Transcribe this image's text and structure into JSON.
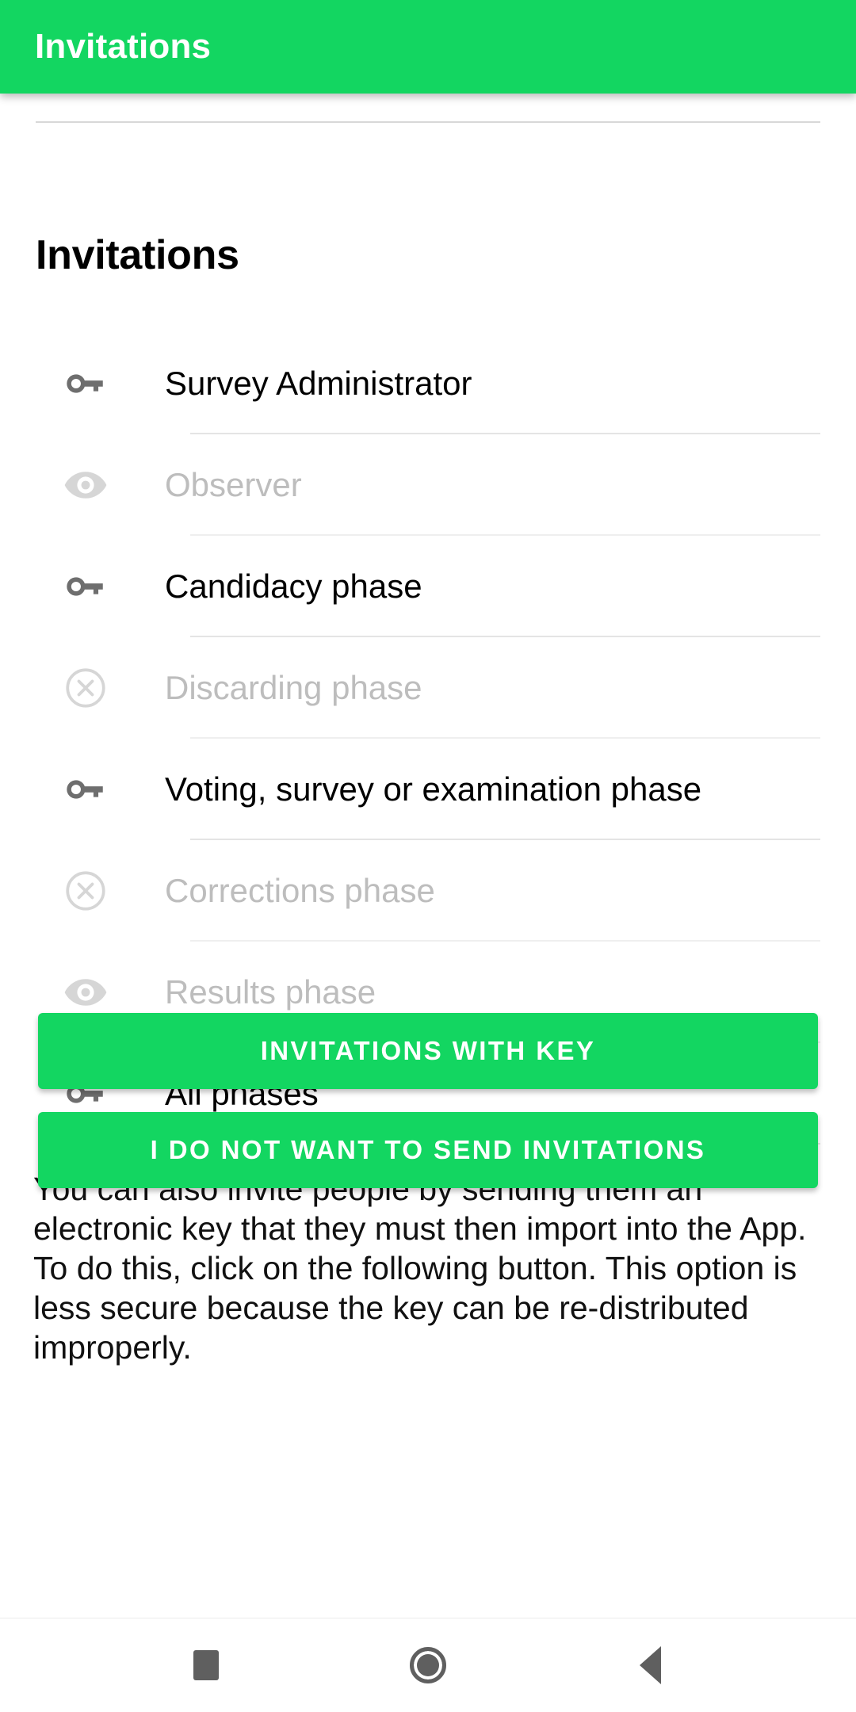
{
  "appbar": {
    "title": "Invitations",
    "background_color": "#13d661",
    "title_color": "#ffffff"
  },
  "section": {
    "heading": "Invitations"
  },
  "list": {
    "items": [
      {
        "icon": "key-icon",
        "label": "Survey Administrator",
        "enabled": true
      },
      {
        "icon": "eye-icon",
        "label": "Observer",
        "enabled": false
      },
      {
        "icon": "key-icon",
        "label": "Candidacy phase",
        "enabled": true
      },
      {
        "icon": "x-circle-icon",
        "label": "Discarding phase",
        "enabled": false
      },
      {
        "icon": "key-icon",
        "label": "Voting, survey or examination phase",
        "enabled": true
      },
      {
        "icon": "x-circle-icon",
        "label": "Corrections phase",
        "enabled": false
      },
      {
        "icon": "eye-icon",
        "label": "Results phase",
        "enabled": false
      },
      {
        "icon": "key-icon",
        "label": "All phases",
        "enabled": true
      }
    ]
  },
  "body": {
    "paragraph": "You can also invite people by sending them an electronic key that they must then import into the App. To do this, click on the following button. This option is less secure because the key can be re-distributed improperly."
  },
  "buttons": {
    "invitations_with_key": "Invitations with key",
    "no_invitations": "I do not want to send invitations",
    "color": "#13d661",
    "text_color": "#ffffff"
  },
  "navbar": {
    "recents": "recents-square-icon",
    "home": "home-circle-icon",
    "back": "back-triangle-icon"
  },
  "colors": {
    "accent_green": "#13d661",
    "enabled_text": "#000000",
    "disabled_text": "#bdbdbd",
    "enabled_icon": "#6e6e6e",
    "disabled_icon": "#d6d6d6",
    "divider": "#e4e4e4"
  }
}
